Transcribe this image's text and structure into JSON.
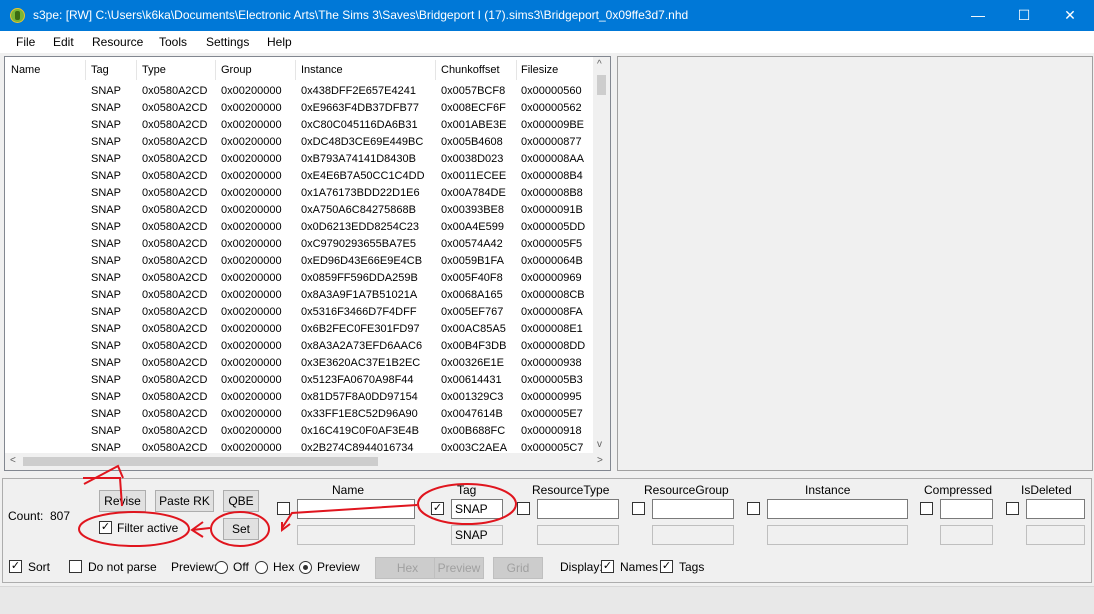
{
  "window": {
    "title": "s3pe: [RW] C:\\Users\\k6ka\\Documents\\Electronic Arts\\The Sims 3\\Saves\\Bridgeport I (17).sims3\\Bridgeport_0x09ffe3d7.nhd",
    "minimize": "—",
    "maximize": "☐",
    "close": "✕"
  },
  "menu": [
    "File",
    "Edit",
    "Resource",
    "Tools",
    "Settings",
    "Help"
  ],
  "columns": [
    "Name",
    "Tag",
    "Type",
    "Group",
    "Instance",
    "Chunkoffset",
    "Filesize"
  ],
  "rows": [
    {
      "tag": "SNAP",
      "type": "0x0580A2CD",
      "group": "0x00200000",
      "instance": "0x438DFF2E657E4241",
      "chunk": "0x0057BCF8",
      "size": "0x00000560"
    },
    {
      "tag": "SNAP",
      "type": "0x0580A2CD",
      "group": "0x00200000",
      "instance": "0xE9663F4DB37DFB77",
      "chunk": "0x008ECF6F",
      "size": "0x00000562"
    },
    {
      "tag": "SNAP",
      "type": "0x0580A2CD",
      "group": "0x00200000",
      "instance": "0xC80C045116DA6B31",
      "chunk": "0x001ABE3E",
      "size": "0x000009BE"
    },
    {
      "tag": "SNAP",
      "type": "0x0580A2CD",
      "group": "0x00200000",
      "instance": "0xDC48D3CE69E449BC",
      "chunk": "0x005B4608",
      "size": "0x00000877"
    },
    {
      "tag": "SNAP",
      "type": "0x0580A2CD",
      "group": "0x00200000",
      "instance": "0xB793A74141D8430B",
      "chunk": "0x0038D023",
      "size": "0x000008AA"
    },
    {
      "tag": "SNAP",
      "type": "0x0580A2CD",
      "group": "0x00200000",
      "instance": "0xE4E6B7A50CC1C4DD",
      "chunk": "0x0011ECEE",
      "size": "0x000008B4"
    },
    {
      "tag": "SNAP",
      "type": "0x0580A2CD",
      "group": "0x00200000",
      "instance": "0x1A76173BDD22D1E6",
      "chunk": "0x00A784DE",
      "size": "0x000008B8"
    },
    {
      "tag": "SNAP",
      "type": "0x0580A2CD",
      "group": "0x00200000",
      "instance": "0xA750A6C84275868B",
      "chunk": "0x00393BE8",
      "size": "0x0000091B"
    },
    {
      "tag": "SNAP",
      "type": "0x0580A2CD",
      "group": "0x00200000",
      "instance": "0x0D6213EDD8254C23",
      "chunk": "0x00A4E599",
      "size": "0x000005DD"
    },
    {
      "tag": "SNAP",
      "type": "0x0580A2CD",
      "group": "0x00200000",
      "instance": "0xC9790293655BA7E5",
      "chunk": "0x00574A42",
      "size": "0x000005F5"
    },
    {
      "tag": "SNAP",
      "type": "0x0580A2CD",
      "group": "0x00200000",
      "instance": "0xED96D43E66E9E4CB",
      "chunk": "0x0059B1FA",
      "size": "0x0000064B"
    },
    {
      "tag": "SNAP",
      "type": "0x0580A2CD",
      "group": "0x00200000",
      "instance": "0x0859FF596DDA259B",
      "chunk": "0x005F40F8",
      "size": "0x00000969"
    },
    {
      "tag": "SNAP",
      "type": "0x0580A2CD",
      "group": "0x00200000",
      "instance": "0x8A3A9F1A7B51021A",
      "chunk": "0x0068A165",
      "size": "0x000008CB"
    },
    {
      "tag": "SNAP",
      "type": "0x0580A2CD",
      "group": "0x00200000",
      "instance": "0x5316F3466D7F4DFF",
      "chunk": "0x005EF767",
      "size": "0x000008FA"
    },
    {
      "tag": "SNAP",
      "type": "0x0580A2CD",
      "group": "0x00200000",
      "instance": "0x6B2FEC0FE301FD97",
      "chunk": "0x00AC85A5",
      "size": "0x000008E1"
    },
    {
      "tag": "SNAP",
      "type": "0x0580A2CD",
      "group": "0x00200000",
      "instance": "0x8A3A2A73EFD6AAC6",
      "chunk": "0x00B4F3DB",
      "size": "0x000008DD"
    },
    {
      "tag": "SNAP",
      "type": "0x0580A2CD",
      "group": "0x00200000",
      "instance": "0x3E3620AC37E1B2EC",
      "chunk": "0x00326E1E",
      "size": "0x00000938"
    },
    {
      "tag": "SNAP",
      "type": "0x0580A2CD",
      "group": "0x00200000",
      "instance": "0x5123FA0670A98F44",
      "chunk": "0x00614431",
      "size": "0x000005B3"
    },
    {
      "tag": "SNAP",
      "type": "0x0580A2CD",
      "group": "0x00200000",
      "instance": "0x81D57F8A0DD97154",
      "chunk": "0x001329C3",
      "size": "0x00000995"
    },
    {
      "tag": "SNAP",
      "type": "0x0580A2CD",
      "group": "0x00200000",
      "instance": "0x33FF1E8C52D96A90",
      "chunk": "0x0047614B",
      "size": "0x000005E7"
    },
    {
      "tag": "SNAP",
      "type": "0x0580A2CD",
      "group": "0x00200000",
      "instance": "0x16C419C0F0AF3E4B",
      "chunk": "0x00B688FC",
      "size": "0x00000918"
    },
    {
      "tag": "SNAP",
      "type": "0x0580A2CD",
      "group": "0x00200000",
      "instance": "0x2B274C8944016734",
      "chunk": "0x003C2AEA",
      "size": "0x000005C7"
    }
  ],
  "scroll": {
    "up": "^",
    "down": "v",
    "left": "<",
    "right": ">"
  },
  "bottom": {
    "count_label": "Count:",
    "count_value": "807",
    "revise": "Revise",
    "paste_rk": "Paste RK",
    "qbe": "QBE",
    "filter_active": "Filter active",
    "filter_active_checked": "✓",
    "set": "Set",
    "filter_headers": [
      "Name",
      "Tag",
      "ResourceType",
      "ResourceGroup",
      "Instance",
      "Compressed",
      "IsDeleted"
    ],
    "tag_checked": "✓",
    "tag_value": "SNAP",
    "tag_current": "SNAP",
    "sort": "Sort",
    "sort_checked": "✓",
    "do_not_parse": "Do not parse",
    "preview_label": "Preview:",
    "preview_off": "Off",
    "preview_hex": "Hex",
    "preview_preview": "Preview",
    "hex_btn": "Hex",
    "preview_btn": "Preview",
    "grid_btn": "Grid",
    "display_label": "Display:",
    "names": "Names",
    "names_checked": "✓",
    "tags": "Tags",
    "tags_checked": "✓"
  },
  "colors": {
    "titlebar": "#0078d7",
    "annotation": "#e0151e"
  }
}
